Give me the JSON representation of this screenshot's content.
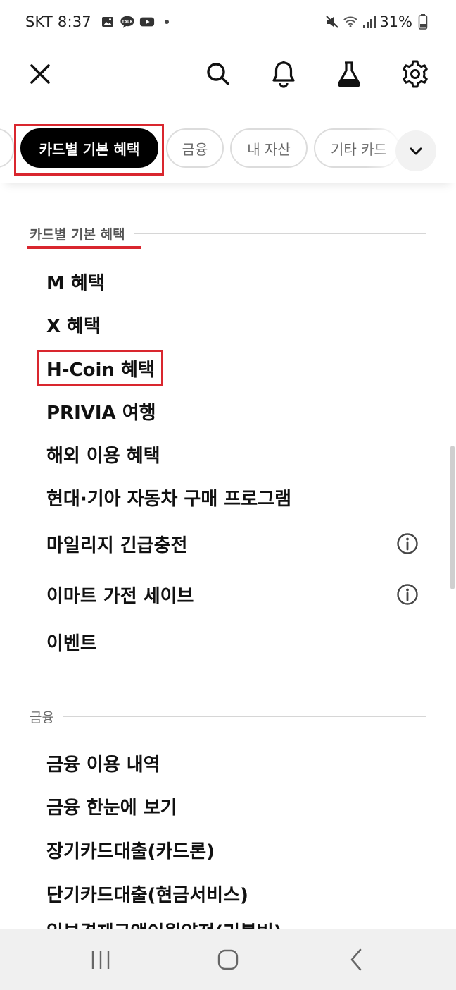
{
  "status_bar": {
    "carrier": "SKT",
    "time": "8:37",
    "battery": "31%",
    "left_icons": [
      "gallery-icon",
      "kakaotalk-icon",
      "youtube-icon",
      "dot-icon"
    ],
    "right_icons": [
      "mute-icon",
      "wifi-icon",
      "signal-icon",
      "battery-icon"
    ]
  },
  "toolbar": {
    "icons": [
      "close-icon",
      "search-icon",
      "bell-icon",
      "flask-icon",
      "gear-icon"
    ]
  },
  "chips": {
    "active": "카드별 기본 혜택",
    "finance": "금융",
    "assets": "내 자산",
    "other": "기타 카드"
  },
  "sections": [
    {
      "title": "카드별 기본 혜택",
      "items": [
        "M 혜택",
        "X 혜택",
        "H-Coin 혜택",
        "PRIVIA 여행",
        "해외 이용 혜택",
        "현대·기아 자동차 구매 프로그램",
        "마일리지 긴급충전",
        "이마트 가전 세이브",
        "이벤트"
      ]
    },
    {
      "title": "금융",
      "items": [
        "금융 이용 내역",
        "금융 한눈에 보기",
        "장기카드대출(카드론)",
        "단기카드대출(현금서비스)",
        "일부결제금액이월약정(리볼빙)"
      ]
    }
  ],
  "colors": {
    "highlight": "#d9262e",
    "chip_active_bg": "#000000",
    "nav_bg": "#f0f0f0"
  }
}
